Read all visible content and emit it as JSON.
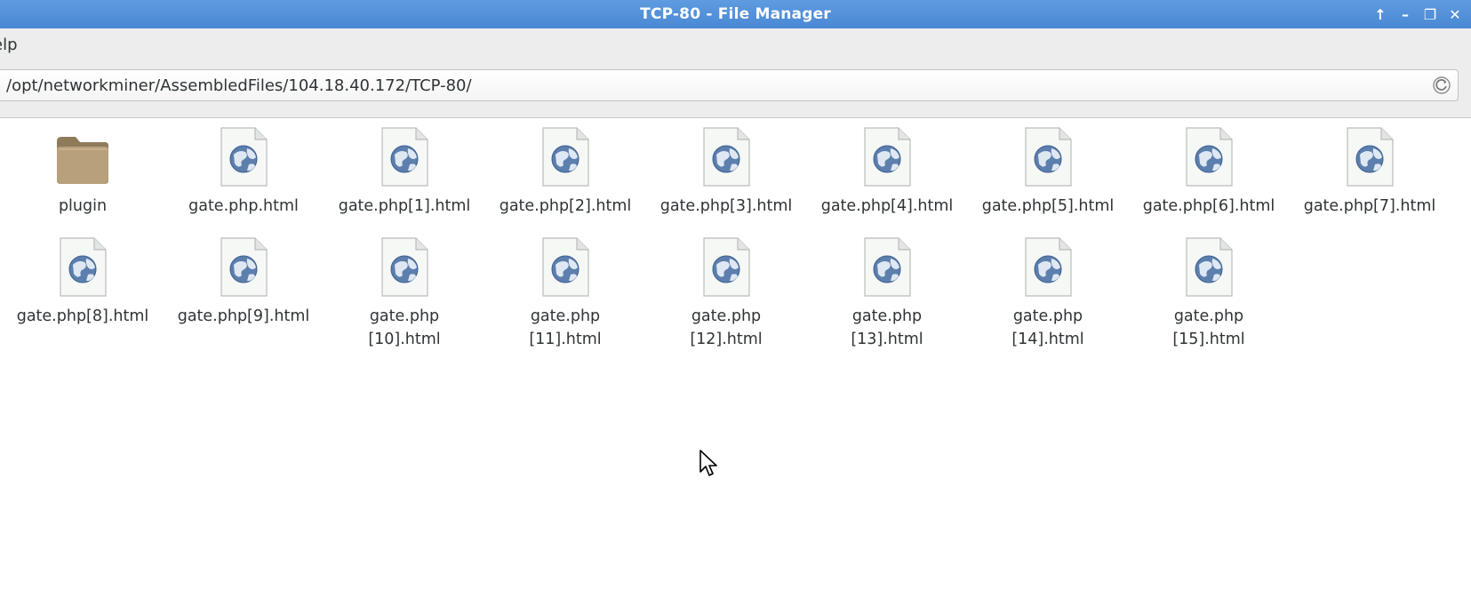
{
  "window": {
    "title": "TCP-80 - File Manager",
    "controls": {
      "up": "↑",
      "minimize": "–",
      "restore": "❐",
      "close": "✕"
    }
  },
  "menubar": {
    "help_label": "elp"
  },
  "location": {
    "path": "/opt/networkminer/AssembledFiles/104.18.40.172/TCP-80/"
  },
  "items": [
    {
      "name": "plugin",
      "type": "folder"
    },
    {
      "name": "gate.php.html",
      "type": "html"
    },
    {
      "name": "gate.php[1].html",
      "type": "html"
    },
    {
      "name": "gate.php[2].html",
      "type": "html"
    },
    {
      "name": "gate.php[3].html",
      "type": "html"
    },
    {
      "name": "gate.php[4].html",
      "type": "html"
    },
    {
      "name": "gate.php[5].html",
      "type": "html"
    },
    {
      "name": "gate.php[6].html",
      "type": "html"
    },
    {
      "name": "gate.php[7].html",
      "type": "html"
    },
    {
      "name": "gate.php[8].html",
      "type": "html"
    },
    {
      "name": "gate.php[9].html",
      "type": "html"
    },
    {
      "name": "gate.php\n[10].html",
      "type": "html"
    },
    {
      "name": "gate.php\n[11].html",
      "type": "html"
    },
    {
      "name": "gate.php\n[12].html",
      "type": "html"
    },
    {
      "name": "gate.php\n[13].html",
      "type": "html"
    },
    {
      "name": "gate.php\n[14].html",
      "type": "html"
    },
    {
      "name": "gate.php\n[15].html",
      "type": "html"
    }
  ],
  "colors": {
    "titlebar": "#4a88d4",
    "folder": "#b39a74"
  }
}
